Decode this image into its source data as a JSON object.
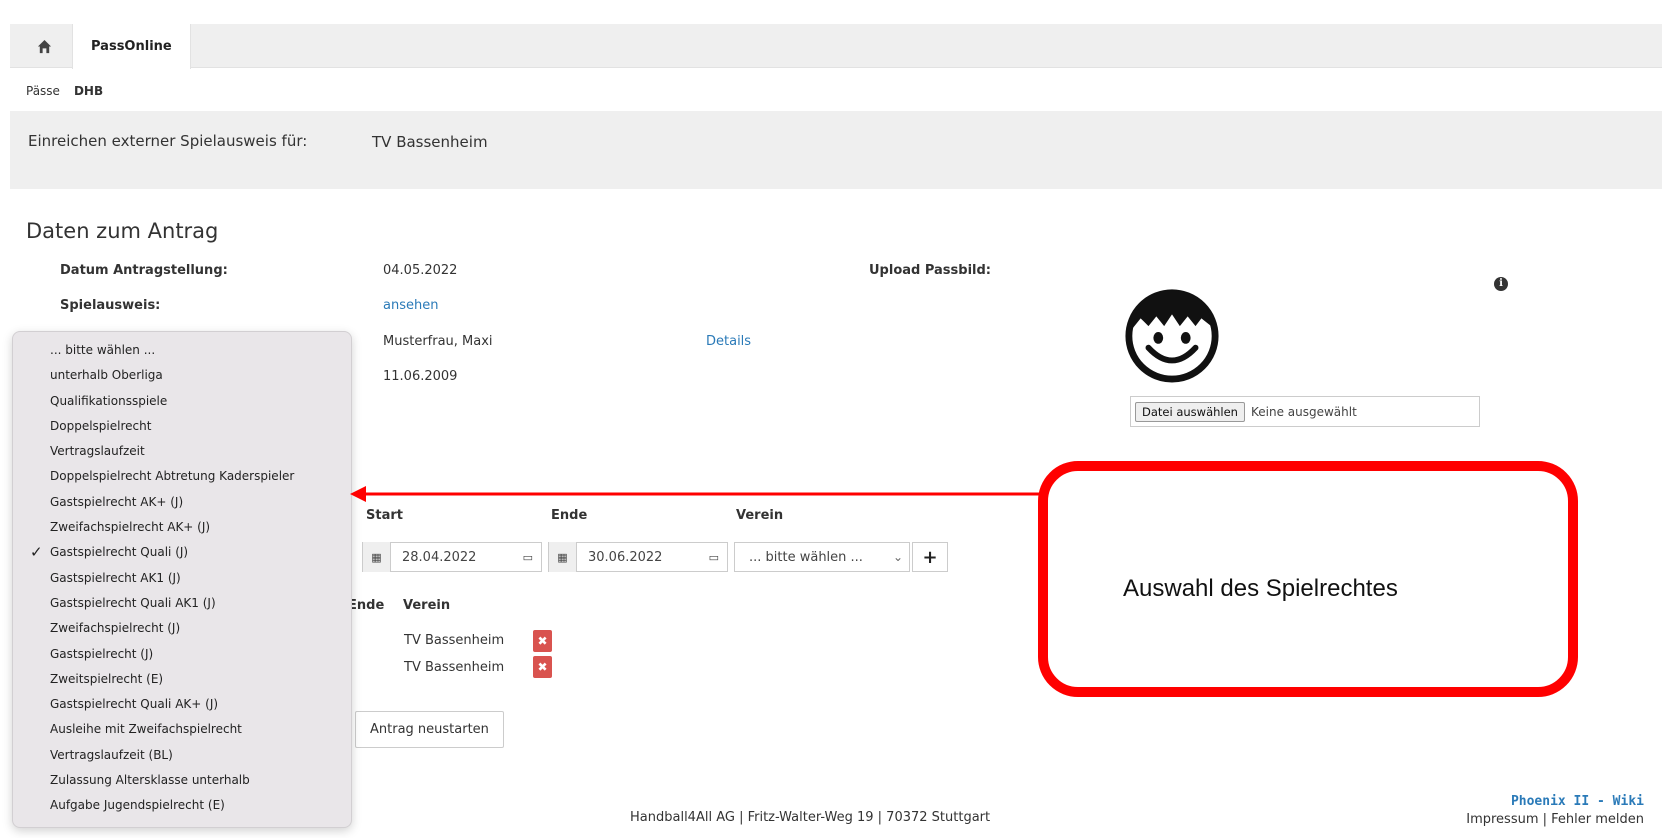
{
  "tabs": {
    "home_icon": "home-icon",
    "active_label": "PassOnline"
  },
  "subnav": {
    "item1": "Pässe",
    "item2": "DHB"
  },
  "banner": {
    "label": "Einreichen externer Spielausweis für:",
    "club": "TV Bassenheim"
  },
  "section_title": "Daten zum Antrag",
  "fields": {
    "datum_label": "Datum Antragstellung:",
    "datum_value": "04.05.2022",
    "spielausweis_label": "Spielausweis:",
    "spielausweis_link": "ansehen",
    "name_value": "Musterfrau, Maxi",
    "details_link": "Details",
    "birth_value": "11.06.2009",
    "upload_label": "Upload Passbild:",
    "file_button": "Datei auswählen",
    "file_none": "Keine ausgewählt"
  },
  "new_row": {
    "col_start": "Start",
    "col_ende": "Ende",
    "col_verein": "Verein",
    "start_value": "28.04.2022",
    "ende_value": "30.06.2022",
    "verein_placeholder": "... bitte wählen ...",
    "add_icon": "plus-icon"
  },
  "existing_rows": {
    "col_ende": "Ende",
    "col_verein": "Verein",
    "rows": [
      {
        "verein": "TV Bassenheim"
      },
      {
        "verein": "TV Bassenheim"
      }
    ]
  },
  "buttons": {
    "restart": "Antrag neustarten"
  },
  "dropdown": {
    "selected_index": 8,
    "options": [
      "... bitte wählen ...",
      "unterhalb Oberliga",
      "Qualifikationsspiele",
      "Doppelspielrecht",
      "Vertragslaufzeit",
      "Doppelspielrecht Abtretung Kaderspieler",
      "Gastspielrecht AK+ (J)",
      "Zweifachspielrecht AK+ (J)",
      "Gastspielrecht Quali (J)",
      "Gastspielrecht AK1 (J)",
      "Gastspielrecht Quali AK1 (J)",
      "Zweifachspielrecht (J)",
      "Gastspielrecht (J)",
      "Zweitspielrecht (E)",
      "Gastspielrecht Quali AK+ (J)",
      "Ausleihe mit Zweifachspielrecht",
      "Vertragslaufzeit (BL)",
      "Zulassung Altersklasse unterhalb",
      "Aufgabe Jugendspielrecht (E)"
    ]
  },
  "callout": {
    "text": "Auswahl des Spielrechtes",
    "color": "#ff0000"
  },
  "footer": {
    "address": "Handball4All AG | Fritz-Walter-Weg 19 | 70372 Stuttgart",
    "wiki": "Phoenix II - Wiki",
    "links": "Impressum | Fehler melden"
  },
  "colors": {
    "link": "#2a7ab8",
    "delete": "#d9534f",
    "annotation": "#ff0000"
  }
}
